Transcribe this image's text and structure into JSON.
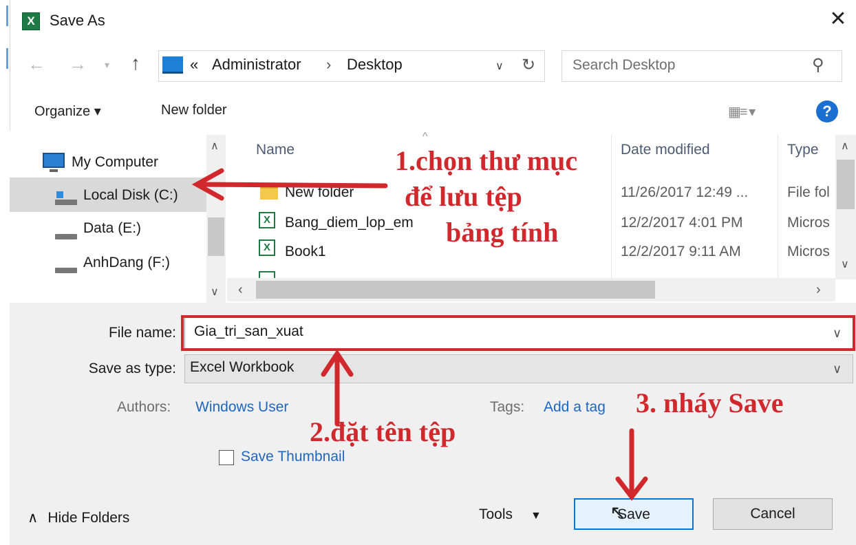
{
  "window": {
    "title": "Save As",
    "app_icon": "X"
  },
  "nav": {
    "path": [
      "Administrator",
      "Desktop"
    ],
    "path_prefix": "«",
    "search_placeholder": "Search Desktop"
  },
  "toolbar": {
    "organize": "Organize ▾",
    "new_folder": "New folder"
  },
  "sidebar": {
    "items": [
      {
        "label": "My Computer",
        "icon": "computer-icon"
      },
      {
        "label": "Local Disk (C:)",
        "icon": "drive-icon",
        "selected": true
      },
      {
        "label": "Data (E:)",
        "icon": "drive-icon"
      },
      {
        "label": "AnhDang (F:)",
        "icon": "drive-icon"
      }
    ]
  },
  "file_list": {
    "columns": [
      "Name",
      "Date modified",
      "Type"
    ],
    "rows": [
      {
        "name": "New folder",
        "date": "11/26/2017 12:49 ...",
        "type": "File fol",
        "icon": "folder-icon"
      },
      {
        "name": "Bang_diem_lop_em",
        "date": "12/2/2017 4:01 PM",
        "type": "Micros",
        "icon": "excel-file-icon"
      },
      {
        "name": "Book1",
        "date": "12/2/2017 9:11 AM",
        "type": "Micros",
        "icon": "excel-file-icon"
      }
    ]
  },
  "form": {
    "file_name_label": "File name:",
    "file_name_value": "Gia_tri_san_xuat",
    "save_type_label": "Save as type:",
    "save_type_value": "Excel Workbook",
    "authors_label": "Authors:",
    "authors_value": "Windows User",
    "tags_label": "Tags:",
    "tags_value": "Add a tag",
    "thumbnail_label": "Save Thumbnail"
  },
  "footer": {
    "hide_folders": "Hide Folders",
    "tools": "Tools",
    "save": "Save",
    "cancel": "Cancel"
  },
  "annotations": {
    "step1_line1": "1.chọn thư mục",
    "step1_line2": "để lưu tệp",
    "step1_line3": "bảng tính",
    "step2": "2.đặt tên tệp",
    "step3": "3. nháy Save",
    "color": "#d1282e"
  },
  "colors": {
    "accent": "#0078d7",
    "link": "#1f66c1",
    "excel": "#1d7a45"
  }
}
